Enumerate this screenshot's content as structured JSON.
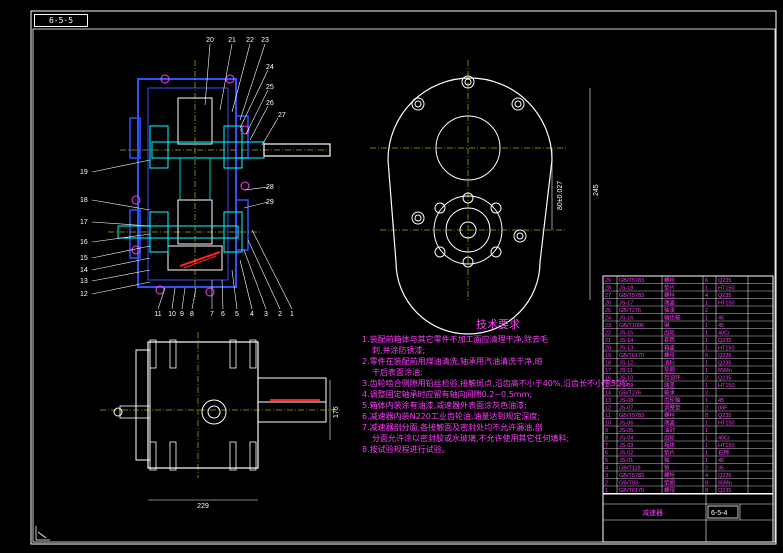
{
  "drawing_tag": "6-5-5",
  "tech_title": "技术要求",
  "tech_lines": [
    {
      "text": "1.装配前箱体与其它零件不加工面应清理干净,除去毛",
      "indent": false
    },
    {
      "text": "刺,并涂防锈漆;",
      "indent": true
    },
    {
      "text": "2.零件在装配前用煤油清洗,轴承用汽油清洗干净,晾",
      "indent": false
    },
    {
      "text": "干后表面涂油;",
      "indent": true
    },
    {
      "text": "3.齿轮啮合侧隙用铅丝检验,接触斑点,沿齿高不小于40%,沿齿长不小于50%",
      "indent": false
    },
    {
      "text": "4.调整固定轴承时应留有轴向间隙0.2~0.5mm;",
      "indent": false
    },
    {
      "text": "5.箱体内装涂有油漆,减速器外表面涂灰色油漆;",
      "indent": false
    },
    {
      "text": "6.减速器内装N220工业齿轮油,油量达到规定深度;",
      "indent": false
    },
    {
      "text": "7.减速器剖分面,各接触面及密封处均不允许漏油,剖",
      "indent": false
    },
    {
      "text": "分面允许涂以密封胶或水玻璃,不允许使用其它任何填料;",
      "indent": true
    },
    {
      "text": "8.按试验规程进行试验。",
      "indent": false
    }
  ],
  "part_numbers_top": [
    "20",
    "21",
    "22",
    "23"
  ],
  "part_numbers_right": [
    "24",
    "25",
    "26",
    "27",
    "28",
    "29"
  ],
  "part_numbers_left": [
    "19",
    "18",
    "17",
    "16",
    "15",
    "14",
    "13",
    "12"
  ],
  "part_numbers_bottom": [
    "11",
    "10",
    "9",
    "8",
    "7",
    "6",
    "5",
    "4",
    "3",
    "2",
    "1"
  ],
  "dimensions": {
    "height_right": "245",
    "center_distance": "80±0.027",
    "side_width": "175",
    "bottom_width": "229"
  },
  "bom_rows": [
    {
      "no": "29",
      "code": "GB/T5783",
      "name": "螺栓",
      "qty": "6",
      "mat": "Q235"
    },
    {
      "no": "28",
      "code": "JS-18",
      "name": "垫片",
      "qty": "1",
      "mat": "HT150"
    },
    {
      "no": "27",
      "code": "GB/T5783",
      "name": "螺栓",
      "qty": "4",
      "mat": "Q235"
    },
    {
      "no": "26",
      "code": "JS-17",
      "name": "端盖",
      "qty": "1",
      "mat": "HT150"
    },
    {
      "no": "25",
      "code": "GB/T276",
      "name": "轴承",
      "qty": "2",
      "mat": ""
    },
    {
      "no": "24",
      "code": "JS-16",
      "name": "输出轴",
      "qty": "1",
      "mat": "45"
    },
    {
      "no": "23",
      "code": "GB/T1096",
      "name": "键",
      "qty": "1",
      "mat": "45"
    },
    {
      "no": "22",
      "code": "JS-15",
      "name": "齿轮",
      "qty": "1",
      "mat": "40Cr"
    },
    {
      "no": "21",
      "code": "JS-14",
      "name": "套筒",
      "qty": "1",
      "mat": "Q235"
    },
    {
      "no": "20",
      "code": "JS-13",
      "name": "箱盖",
      "qty": "1",
      "mat": "HT150"
    },
    {
      "no": "19",
      "code": "GB/T6170",
      "name": "螺母",
      "qty": "6",
      "mat": "Q235"
    },
    {
      "no": "18",
      "code": "JS-12",
      "name": "油标",
      "qty": "1",
      "mat": "Q235"
    },
    {
      "no": "17",
      "code": "JS-11",
      "name": "垫圈",
      "qty": "1",
      "mat": "65Mn"
    },
    {
      "no": "16",
      "code": "JS-10",
      "name": "挡油环",
      "qty": "2",
      "mat": "Q235"
    },
    {
      "no": "15",
      "code": "JS-09",
      "name": "端盖",
      "qty": "1",
      "mat": "HT150"
    },
    {
      "no": "14",
      "code": "GB/T276",
      "name": "轴承",
      "qty": "2",
      "mat": ""
    },
    {
      "no": "13",
      "code": "JS-08",
      "name": "齿轮轴",
      "qty": "1",
      "mat": "45"
    },
    {
      "no": "12",
      "code": "JS-07",
      "name": "调整垫",
      "qty": "2",
      "mat": "08F"
    },
    {
      "no": "11",
      "code": "GB/T5783",
      "name": "螺栓",
      "qty": "8",
      "mat": "Q235"
    },
    {
      "no": "10",
      "code": "JS-06",
      "name": "端盖",
      "qty": "1",
      "mat": "HT150"
    },
    {
      "no": "9",
      "code": "JS-05",
      "name": "油封",
      "qty": "1",
      "mat": ""
    },
    {
      "no": "8",
      "code": "JS-04",
      "name": "齿轮",
      "qty": "1",
      "mat": "40Cr"
    },
    {
      "no": "7",
      "code": "JS-03",
      "name": "箱体",
      "qty": "1",
      "mat": "HT150"
    },
    {
      "no": "6",
      "code": "JS-02",
      "name": "垫片",
      "qty": "1",
      "mat": "石棉"
    },
    {
      "no": "5",
      "code": "JS-01",
      "name": "轴",
      "qty": "1",
      "mat": "45"
    },
    {
      "no": "4",
      "code": "GB/T119",
      "name": "销",
      "qty": "2",
      "mat": "35"
    },
    {
      "no": "3",
      "code": "GB/T5783",
      "name": "螺栓",
      "qty": "4",
      "mat": "Q235"
    },
    {
      "no": "2",
      "code": "GB/T93",
      "name": "垫圈",
      "qty": "8",
      "mat": "65Mn"
    },
    {
      "no": "1",
      "code": "GB/T6170",
      "name": "螺母",
      "qty": "8",
      "mat": "Q235"
    }
  ],
  "title_block": {
    "name": "减速器",
    "drawing_no": "6-5-4"
  }
}
